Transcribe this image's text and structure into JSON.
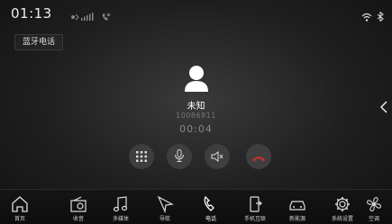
{
  "status_bar": {
    "time": "01:13"
  },
  "header": {
    "tab_label": "蓝牙电话"
  },
  "call": {
    "caller_name": "未知",
    "caller_number": "10086811",
    "duration": "00:04"
  },
  "controls": [
    {
      "name": "keypad-button",
      "icon": "keypad-icon"
    },
    {
      "name": "mic-button",
      "icon": "microphone-icon"
    },
    {
      "name": "speaker-button",
      "icon": "speaker-icon"
    },
    {
      "name": "hangup-button",
      "icon": "hangup-icon"
    }
  ],
  "dock": {
    "items": [
      {
        "label": "首页",
        "icon": "home-icon"
      },
      {
        "label": "收音",
        "icon": "radio-icon"
      },
      {
        "label": "多媒体",
        "icon": "music-icon"
      },
      {
        "label": "导航",
        "icon": "navigation-icon"
      },
      {
        "label": "电话",
        "icon": "phone-icon",
        "active": true
      },
      {
        "label": "手机互联",
        "icon": "phone-link-icon"
      },
      {
        "label": "新能源",
        "icon": "car-icon"
      },
      {
        "label": "系统设置",
        "icon": "gear-icon"
      },
      {
        "label": "空调",
        "icon": "fan-icon"
      }
    ]
  },
  "colors": {
    "accent": "#c9302c",
    "background": "#1f1f1f",
    "button": "#3e3e3e"
  }
}
